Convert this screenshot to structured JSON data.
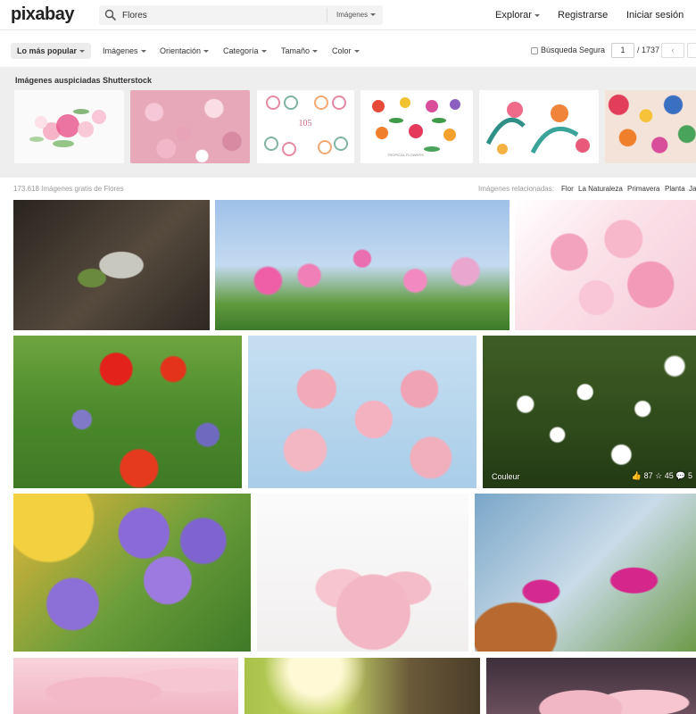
{
  "header": {
    "logo": "pixabay",
    "search_value": "Flores",
    "search_type": "Imágenes",
    "nav": {
      "explore": "Explorar",
      "register": "Registrarse",
      "login": "Iniciar sesión"
    }
  },
  "filters": {
    "sort": "Lo más popular",
    "items": [
      "Imágenes",
      "Orientación",
      "Categoría",
      "Tamaño",
      "Color"
    ],
    "safe_search": "Búsqueda Segura",
    "page_current": "1",
    "page_total": "/ 1737",
    "prev": "‹"
  },
  "sponsored": {
    "title": "Imágenes auspiciadas Shutterstock",
    "thumb_text_1": "105",
    "thumb_text_2": "TROPICAL FLOWERS"
  },
  "results": {
    "count": "173.618 Imágenes gratis de Flores",
    "related_label": "Imágenes relacionadas:",
    "related_tags": [
      "Flor",
      "La Naturaleza",
      "Primavera",
      "Planta",
      "Ja"
    ]
  },
  "photos": {
    "caption": "Couleur",
    "likes": "87",
    "favorites": "45",
    "comments": "5"
  },
  "colors": {
    "sponsored_bg": "#eeeeee",
    "accent_green": "#48a947"
  }
}
